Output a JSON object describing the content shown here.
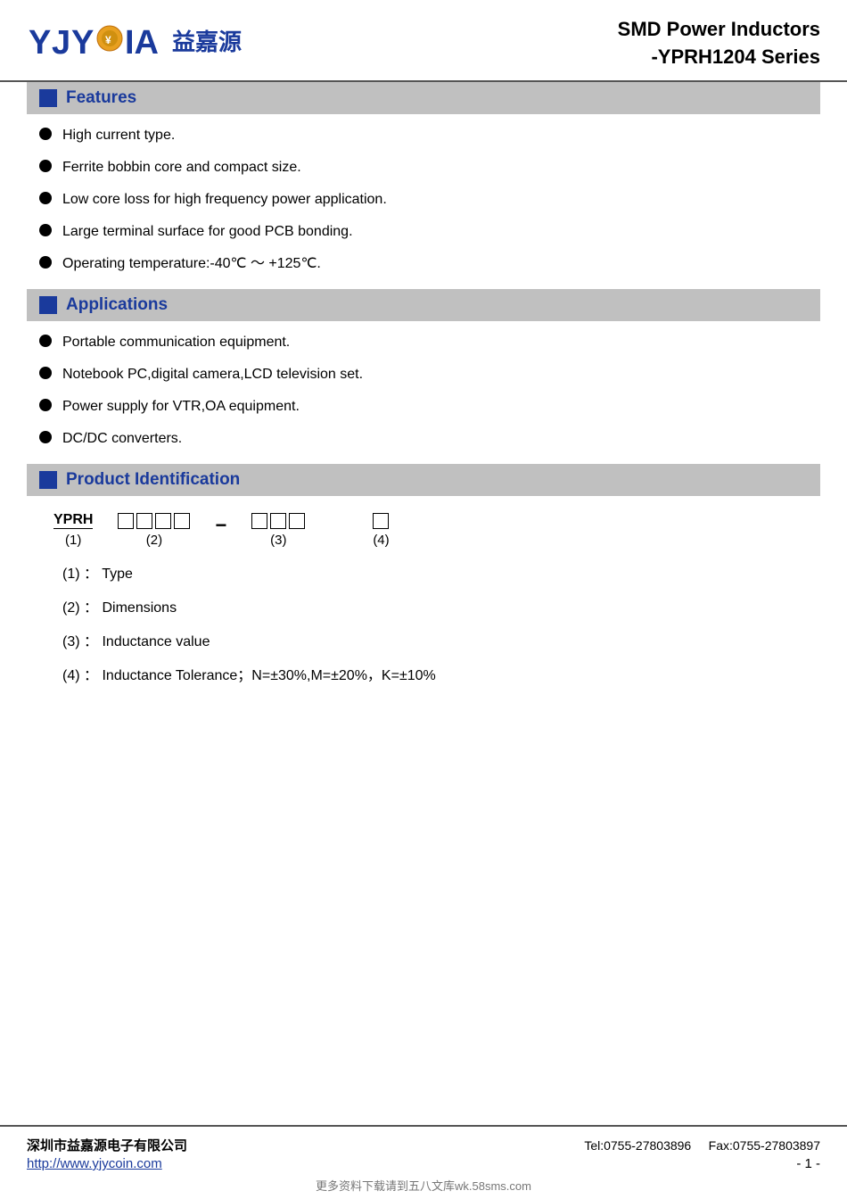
{
  "header": {
    "logo_text": "YJYC●IA",
    "logo_cn": "益嘉源",
    "title_line1": "SMD Power Inductors",
    "title_line2": "-YPRH1204 Series"
  },
  "sections": {
    "features": {
      "title": "Features",
      "items": [
        "High current type.",
        "Ferrite bobbin core and compact size.",
        "Low core loss for high frequency power application.",
        "Large terminal surface for good PCB bonding.",
        "Operating temperature:-40℃ ～ +125℃."
      ]
    },
    "applications": {
      "title": "Applications",
      "items": [
        "Portable communication equipment.",
        "Notebook PC,digital camera,LCD television set.",
        "Power supply for VTR,OA equipment.",
        "DC/DC converters."
      ]
    },
    "product_id": {
      "title": "Product Identification",
      "diagram": {
        "label": "YPRH",
        "group2_boxes": 4,
        "group3_boxes": 3,
        "group4_boxes": 1,
        "num1": "(1)",
        "num2": "(2)",
        "num3": "(3)",
        "num4": "(4)"
      },
      "details": [
        {
          "num": "(1)",
          "desc": "Type"
        },
        {
          "num": "(2)",
          "desc": "Dimensions"
        },
        {
          "num": "(3)",
          "desc": "Inductance value"
        },
        {
          "num": "(4)",
          "desc": "Inductance Tolerance；N=±30%,M=±20%，K=±10%"
        }
      ]
    }
  },
  "footer": {
    "company": "深圳市益嘉源电子有限公司",
    "tel": "Tel:0755-27803896",
    "fax": "Fax:0755-27803897",
    "url": "http://www.yjycoin.com",
    "page": "- 1 -",
    "watermark": "更多资料下载请到五八文库wk.58sms.com"
  }
}
